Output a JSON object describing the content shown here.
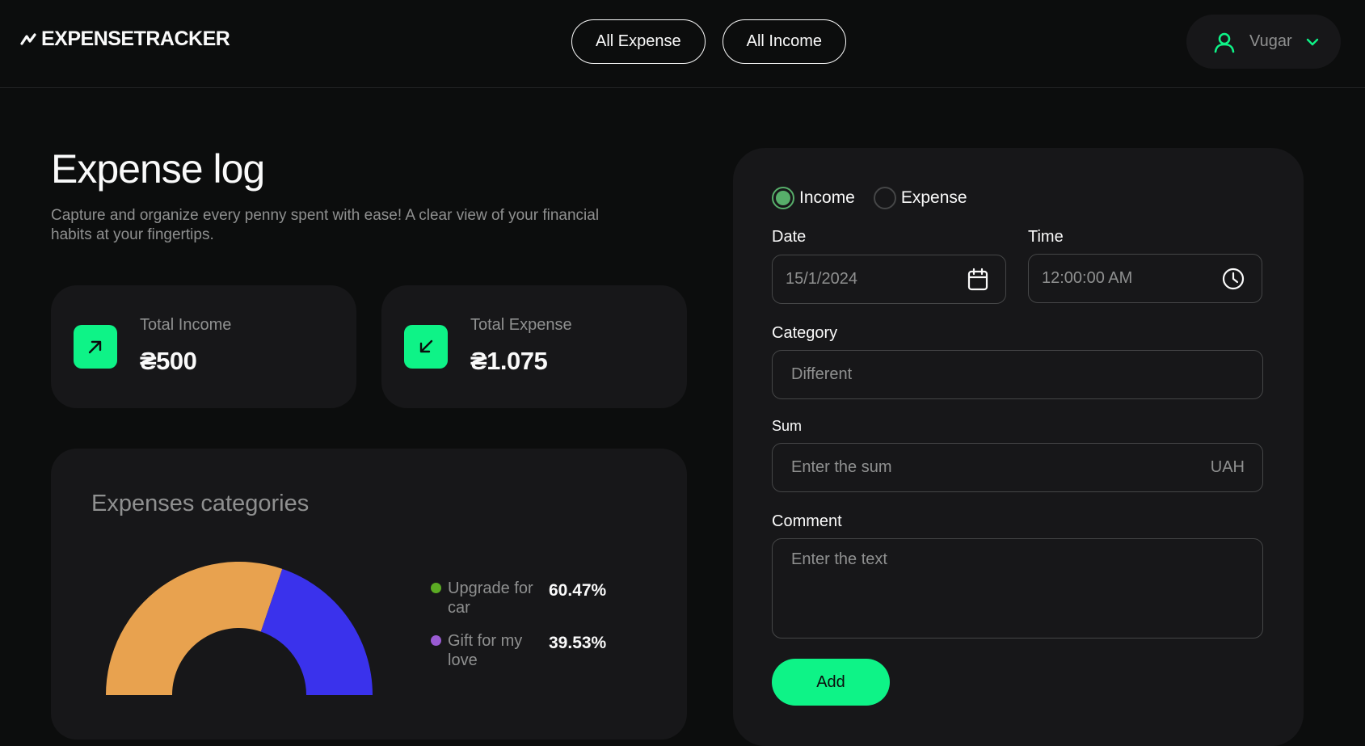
{
  "header": {
    "logo_text": "EXPENSETRACKER",
    "nav": [
      "All Expense",
      "All Income"
    ],
    "user_name": "Vugar"
  },
  "main": {
    "title": "Expense log",
    "subtitle": "Capture and organize every penny spent with ease! A clear view of your financial habits at your fingertips."
  },
  "stats": {
    "income_label": "Total Income",
    "income_value": "₴500",
    "expense_label": "Total Expense",
    "expense_value": "₴1.075"
  },
  "chart": {
    "title": "Expenses categories"
  },
  "chart_data": {
    "type": "pie",
    "categories": [
      "Upgrade for car",
      "Gift for my love"
    ],
    "values": [
      60.47,
      39.53
    ],
    "percent_labels": [
      "60.47%",
      "39.53%"
    ],
    "colors": [
      "#e8a24f",
      "#3a32ec"
    ],
    "legend_dot_colors": [
      "#5bab23",
      "#9a5bd3"
    ],
    "title": "Expenses categories"
  },
  "form": {
    "radio_income": "Income",
    "radio_expense": "Expense",
    "selected": "income",
    "date_label": "Date",
    "date_value": "15/1/2024",
    "time_label": "Time",
    "time_value": "12:00:00 AM",
    "category_label": "Category",
    "category_value": "Different",
    "sum_label": "Sum",
    "sum_placeholder": "Enter the sum",
    "sum_currency": "UAH",
    "comment_label": "Comment",
    "comment_placeholder": "Enter the text",
    "add_label": "Add"
  },
  "colors": {
    "accent": "#0ef387",
    "background": "#0c0d0d",
    "card": "#171719",
    "radio_checked": "#57ae6a"
  },
  "icons": {
    "logo": "zigzag-icon",
    "user": "user-icon",
    "chevron": "chevron-down-icon",
    "income": "arrow-up-right-icon",
    "expense": "arrow-down-left-icon",
    "date": "calendar-icon",
    "time": "clock-icon"
  }
}
